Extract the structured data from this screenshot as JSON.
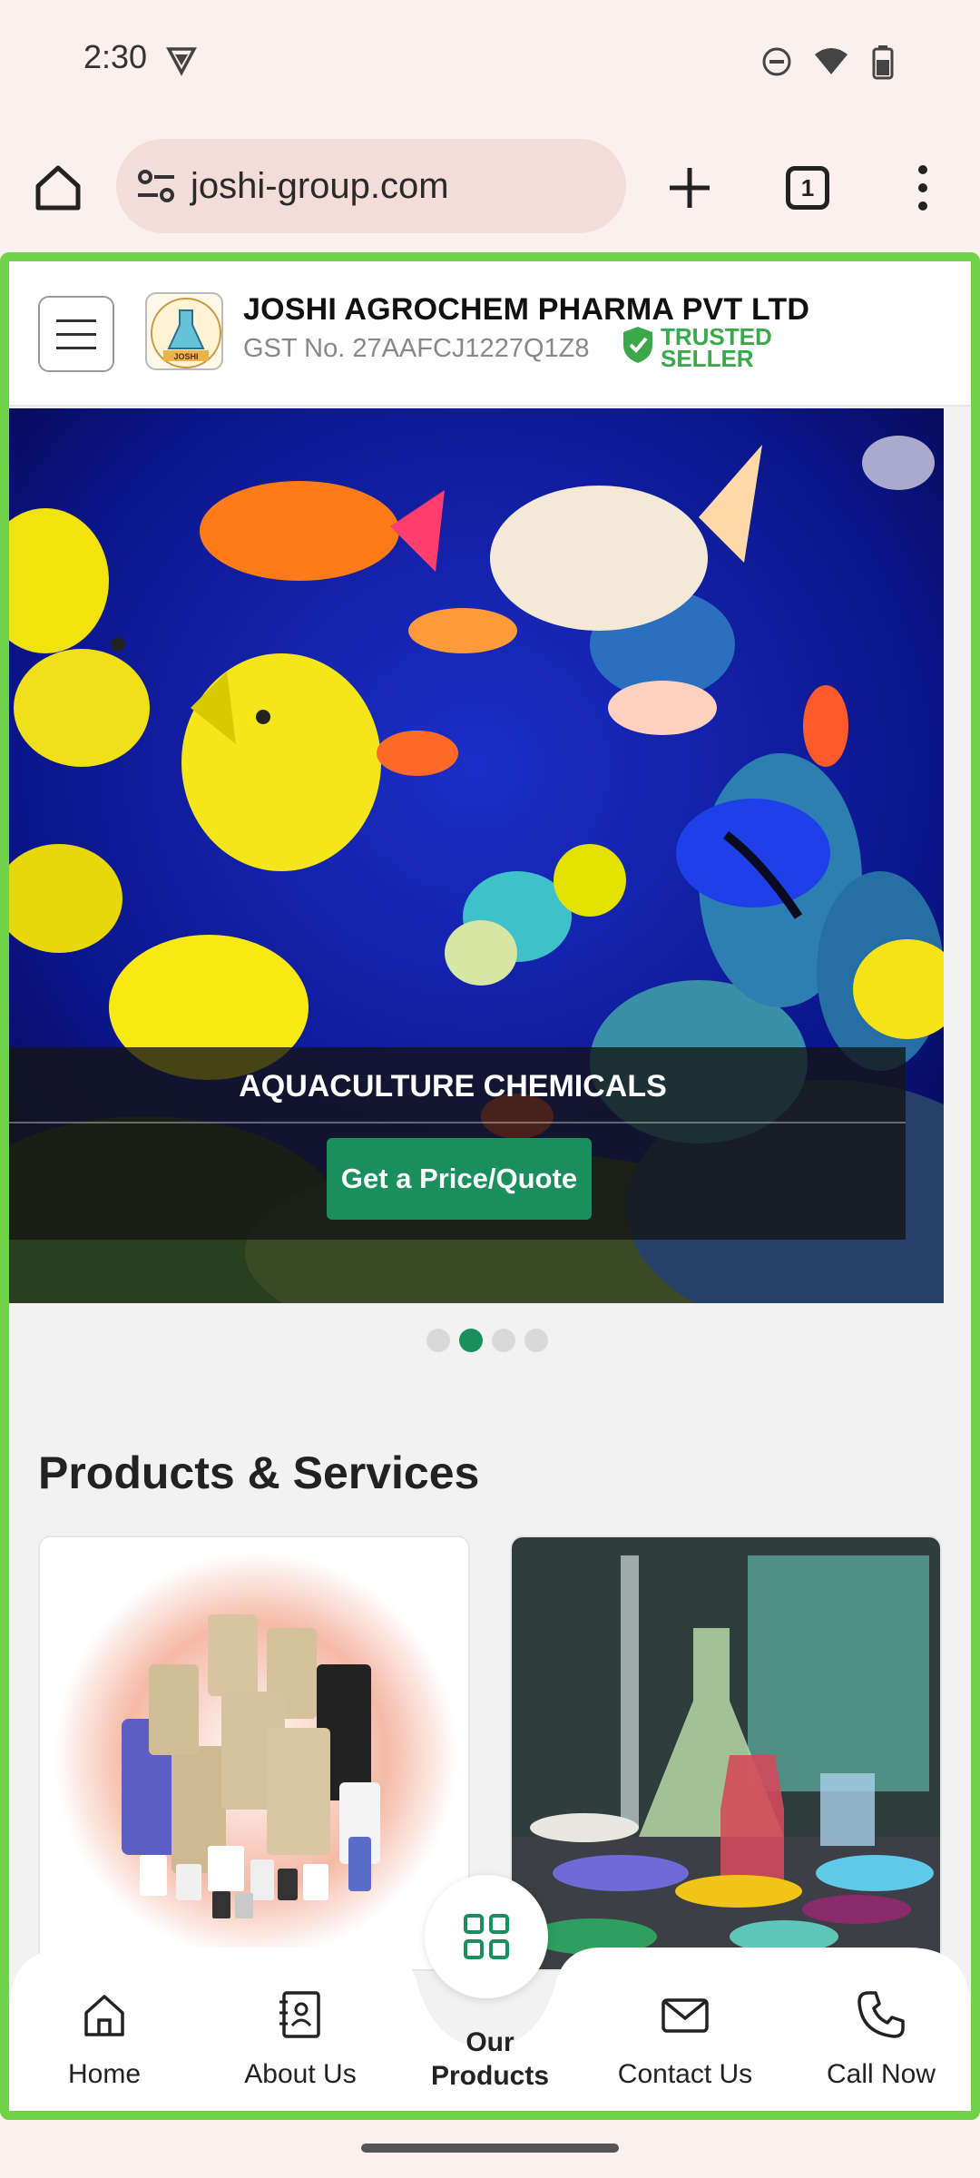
{
  "status_bar": {
    "time": "2:30"
  },
  "browser": {
    "url": "joshi-group.com",
    "tab_count": "1"
  },
  "header": {
    "company_name": "JOSHI AGROCHEM PHARMA PVT LTD",
    "gst_number": "GST No. 27AAFCJ1227Q1Z8",
    "trusted_line1": "TRUSTED",
    "trusted_line2": "SELLER",
    "logo_text": "JOSHI"
  },
  "banner": {
    "caption": "AQUACULTURE CHEMICALS",
    "quote_button": "Get a Price/Quote",
    "slide_count": 4,
    "active_slide": 2
  },
  "products": {
    "section_title": "Products & Services"
  },
  "bottom_nav": {
    "home": "Home",
    "about": "About Us",
    "products_line1": "Our",
    "products_line2": "Products",
    "contact": "Contact Us",
    "call": "Call Now"
  },
  "colors": {
    "brand_green": "#1b8e5d",
    "frame_green": "#6fd34a",
    "trusted_green": "#3aa84b"
  }
}
